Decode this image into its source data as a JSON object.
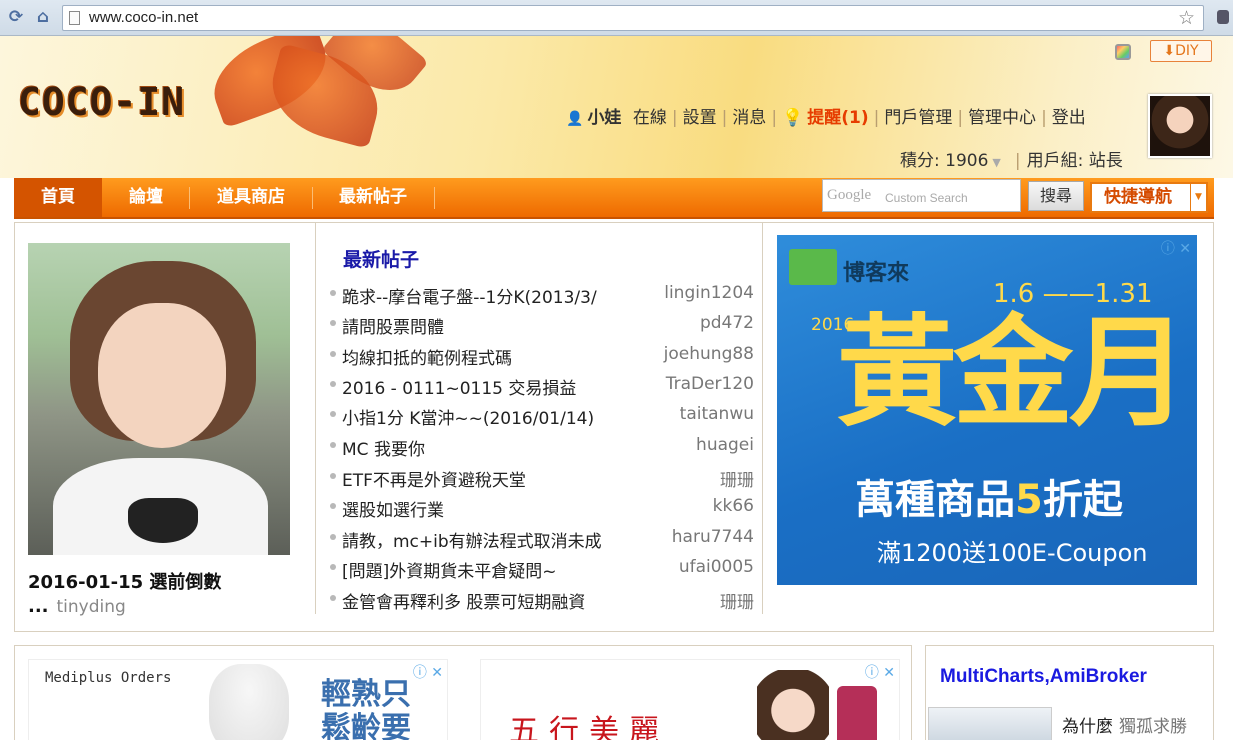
{
  "browser": {
    "url": "www.coco-in.net"
  },
  "header": {
    "logo_text": "COCO-IN",
    "diy_label": "DIY",
    "user_nav": {
      "username": "小娃",
      "status": "在線",
      "items": [
        "設置",
        "消息"
      ],
      "remind_label": "提醒(1)",
      "tail_items": [
        "門戶管理",
        "管理中心",
        "登出"
      ]
    },
    "credits_label": "積分: 1906",
    "usergroup_label": "用戶組: 站長"
  },
  "mainnav": {
    "items": [
      "首頁",
      "論壇",
      "道具商店",
      "最新帖子"
    ],
    "search_brand": "Google",
    "search_sub": "Custom Search",
    "search_button": "搜尋",
    "quick_nav": "快捷導航"
  },
  "feature": {
    "caption": "2016-01-15 選前倒數 ...",
    "author": "tinyding"
  },
  "latest_posts": {
    "title": "最新帖子",
    "rows": [
      {
        "title": "跪求--摩台電子盤--1分K(2013/3/",
        "author": "lingin1204"
      },
      {
        "title": "請問股票問體",
        "author": "pd472"
      },
      {
        "title": "均線扣抵的範例程式碼",
        "author": "joehung88"
      },
      {
        "title": "2016 - 0111~0115 交易損益",
        "author": "TraDer120"
      },
      {
        "title": "小指1分 K當沖~~(2016/01/14)",
        "author": "taitanwu"
      },
      {
        "title": "MC 我要你",
        "author": "huagei"
      },
      {
        "title": "ETF不再是外資避稅天堂",
        "author": "珊珊"
      },
      {
        "title": "選股如選行業",
        "author": "kk66"
      },
      {
        "title": "請教，mc+ib有辦法程式取消未成",
        "author": "haru7744"
      },
      {
        "title": "[問題]外資期貨未平倉疑問~",
        "author": "ufai0005"
      },
      {
        "title": "金管會再釋利多 股票可短期融資",
        "author": "珊珊"
      }
    ]
  },
  "ad_main": {
    "brand": "博客來",
    "dates": "1.6 ——1.31",
    "year": "2016",
    "headline": "黃金月",
    "sub_prefix": "萬種商品",
    "sub_highlight": "5",
    "sub_suffix": "折起",
    "coupon": "滿1200送100E-Coupon"
  },
  "ad_lower_left": {
    "title": "Mediplus Orders",
    "big_text": "輕熟只 鬆齡要"
  },
  "ad_lower_mid": {
    "text": "五行美麗"
  },
  "sidebar": {
    "title": "MultiCharts,AmiBroker",
    "item_title": "為什麼",
    "item_author": "獨孤求勝"
  }
}
